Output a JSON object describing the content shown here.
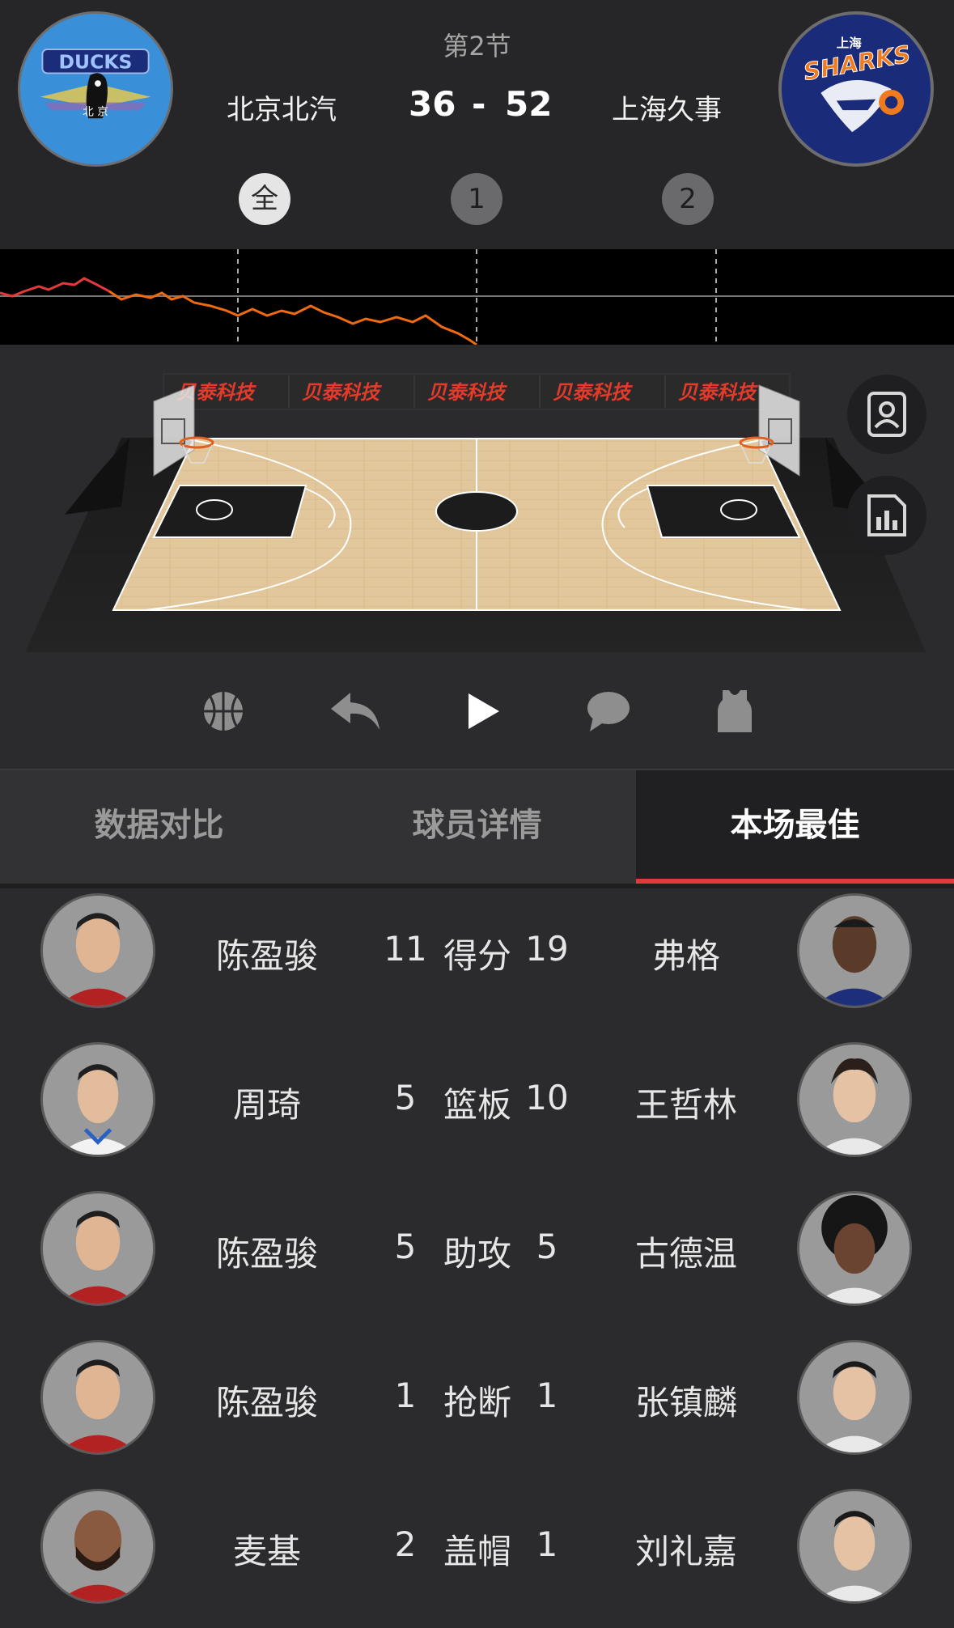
{
  "header": {
    "period": "第2节",
    "home_team": "北京北汽",
    "away_team": "上海久事",
    "home_score": "36",
    "score_separator": "-",
    "away_score": "52",
    "home_logo_text": "DUCKS",
    "home_logo_city": "北  京",
    "away_logo_text": "SHARKS",
    "away_logo_city": "上海",
    "quarters": [
      "全",
      "1",
      "2"
    ],
    "active_quarter": "全"
  },
  "court": {
    "banner_text": "贝泰科技",
    "colors": {
      "wood": "#e2c79c",
      "paint": "#1c1c1c",
      "banner": "#2a2a2a",
      "banner_text": "#e53a2a"
    }
  },
  "trend_colors": {
    "home_line": "#e23a3a",
    "away_line": "#f06a10",
    "baseline": "#777777"
  },
  "side_buttons": [
    "player-card-icon",
    "stats-chart-icon"
  ],
  "controls": [
    "basketball-icon",
    "replay-icon",
    "play-icon",
    "comment-icon",
    "jersey-icon"
  ],
  "tabs": [
    "数据对比",
    "球员详情",
    "本场最佳"
  ],
  "active_tab": "本场最佳",
  "best": [
    {
      "left_name": "陈盈骏",
      "left_value": "11",
      "stat": "得分",
      "right_value": "19",
      "right_name": "弗格"
    },
    {
      "left_name": "周琦",
      "left_value": "5",
      "stat": "篮板",
      "right_value": "10",
      "right_name": "王哲林"
    },
    {
      "left_name": "陈盈骏",
      "left_value": "5",
      "stat": "助攻",
      "right_value": "5",
      "right_name": "古德温"
    },
    {
      "left_name": "陈盈骏",
      "left_value": "1",
      "stat": "抢断",
      "right_value": "1",
      "right_name": "张镇麟"
    },
    {
      "left_name": "麦基",
      "left_value": "2",
      "stat": "盖帽",
      "right_value": "1",
      "right_name": "刘礼嘉"
    }
  ]
}
